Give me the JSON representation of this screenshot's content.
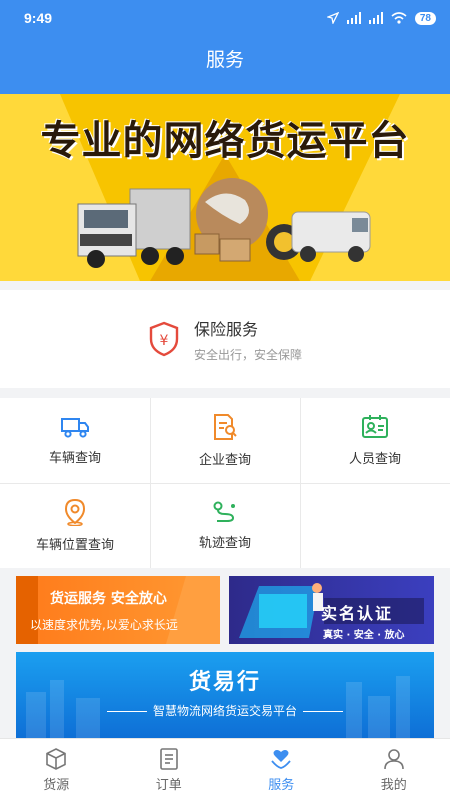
{
  "status": {
    "time": "9:49",
    "battery": "78"
  },
  "header": {
    "title": "服务"
  },
  "banner": {
    "title": "专业的网络货运平台"
  },
  "insurance": {
    "title": "保险服务",
    "subtitle": "安全出行，安全保障",
    "icon": "shield-yuan-icon"
  },
  "grid": {
    "items": [
      {
        "label": "车辆查询",
        "icon": "truck-icon"
      },
      {
        "label": "企业查询",
        "icon": "document-search-icon"
      },
      {
        "label": "人员查询",
        "icon": "id-card-icon"
      },
      {
        "label": "车辆位置查询",
        "icon": "location-pin-icon"
      },
      {
        "label": "轨迹查询",
        "icon": "route-icon"
      }
    ]
  },
  "promo_left": {
    "title": "货运服务  安全放心",
    "subtitle": "以速度求优势,以爱心求长远"
  },
  "promo_right": {
    "title": "实名认证",
    "subtitle": "真实 · 安全 · 放心"
  },
  "trade": {
    "title": "货易行",
    "subtitle": "智慧物流网络货运交易平台"
  },
  "tabbar": {
    "tabs": [
      {
        "label": "货源",
        "icon": "box-icon"
      },
      {
        "label": "订单",
        "icon": "document-icon"
      },
      {
        "label": "服务",
        "icon": "heart-hand-icon"
      },
      {
        "label": "我的",
        "icon": "user-icon"
      }
    ],
    "active": "服务"
  },
  "colors": {
    "primary": "#3d8ef0",
    "banner_yellow": "#f7c400",
    "promo_orange": "#ff8a22",
    "grid_blue": "#2f86f0",
    "grid_orange": "#f08a2b",
    "grid_green": "#2fb15c"
  }
}
